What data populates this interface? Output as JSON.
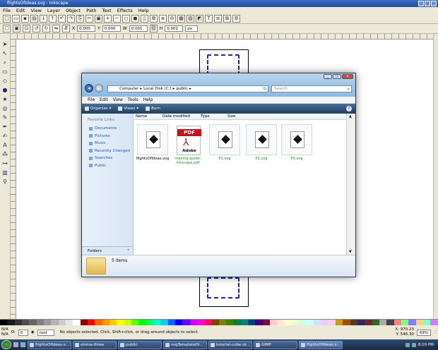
{
  "window": {
    "title": "flightsOfIdeas.svg - Inkscape"
  },
  "menu": [
    "File",
    "Edit",
    "View",
    "Layer",
    "Object",
    "Path",
    "Text",
    "Effects",
    "Help"
  ],
  "toolbar2": {
    "x_label": "X",
    "x": "0.000",
    "y_label": "Y",
    "y": "0.000",
    "w_label": "W",
    "w": "0.001",
    "h_label": "H",
    "h": "0.001",
    "unit": "px"
  },
  "status": {
    "fill_label": "N/A",
    "stroke_label": "N/A",
    "opacity": "0",
    "layer": "root",
    "message": "No objects selected. Click, Shift+click, or drag around objects to select.",
    "x_coord": "X: 970.23",
    "y_coord": "Y: 546.30",
    "zoom": "69%"
  },
  "taskbar": {
    "tasks": [
      "flightsOfIdeas.s...",
      "sinma-three",
      "public",
      "svgTemplateDi...",
      "tutorial-cube.sk...",
      "GIMP",
      "flightsOfIdeas.s..."
    ],
    "active_index": 6,
    "clock": "8:19 PM"
  },
  "explorer": {
    "address": [
      "Computer",
      "Local Disk (C:)",
      "public"
    ],
    "search_placeholder": "Search",
    "menu": [
      "File",
      "Edit",
      "View",
      "Tools",
      "Help"
    ],
    "toolbar": [
      "Organize",
      "Views",
      "Burn"
    ],
    "favorites_title": "Favorite Links",
    "favorites": [
      "Documents",
      "Pictures",
      "Music",
      "Recently Changed",
      "Searches",
      "Public"
    ],
    "folders_label": "Folders",
    "columns": [
      "Name",
      "Date modified",
      "Type",
      "Size"
    ],
    "files": [
      {
        "name": "flightsOfIdeas.svg",
        "kind": "svg",
        "highlight": false
      },
      {
        "name": "making-guide-inkscape.pdf",
        "kind": "pdf",
        "highlight": true
      },
      {
        "name": "P1.svg",
        "kind": "svg",
        "highlight": true
      },
      {
        "name": "P2.svg",
        "kind": "svg",
        "highlight": true
      },
      {
        "name": "P3.svg",
        "kind": "svg",
        "highlight": true
      }
    ],
    "item_count": "5 items",
    "pdf_badge": "PDF",
    "pdf_brand": "Adobe"
  },
  "palette": [
    "#000000",
    "#1a1a1a",
    "#333333",
    "#4d4d4d",
    "#666666",
    "#808080",
    "#999999",
    "#b3b3b3",
    "#cccccc",
    "#e6e6e6",
    "#ffffff",
    "#800000",
    "#ff0000",
    "#ff6600",
    "#ff9900",
    "#ffcc00",
    "#ffff00",
    "#ccff00",
    "#66ff00",
    "#00ff00",
    "#00ff66",
    "#00ffcc",
    "#00ccff",
    "#0066ff",
    "#0000ff",
    "#6600ff",
    "#cc00ff",
    "#ff00cc",
    "#ff0066",
    "#804000",
    "#808000",
    "#408000",
    "#008040",
    "#008080",
    "#004080",
    "#400080",
    "#800040",
    "#ffcccc",
    "#ffe6cc",
    "#ffffcc",
    "#e6ffcc",
    "#ccffe6",
    "#ccffff",
    "#cce6ff",
    "#e6ccff",
    "#ffcce6",
    "#c8a000",
    "#a05000",
    "#5a3a1a",
    "#2a2a6a",
    "#6a2a2a",
    "#2a6a2a",
    "#aaaaaa",
    "#444444",
    "#ff8080",
    "#80ff80",
    "#8080ff",
    "#ffd080",
    "#80ffd0",
    "#d080ff"
  ]
}
